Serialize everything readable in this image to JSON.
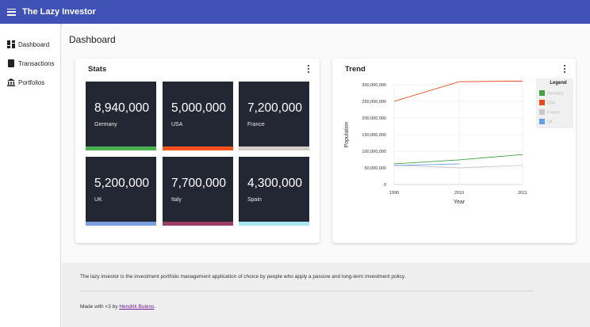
{
  "app": {
    "title": "The Lazy Investor"
  },
  "sidebar": {
    "items": [
      {
        "label": "Dashboard",
        "icon": "dashboard-icon"
      },
      {
        "label": "Transactions",
        "icon": "book-icon"
      },
      {
        "label": "Portfolios",
        "icon": "bank-icon"
      }
    ]
  },
  "page": {
    "title": "Dashboard"
  },
  "stats_card": {
    "title": "Stats",
    "items": [
      {
        "value": "8,940,000",
        "label": "Germany",
        "color": "#4caf50"
      },
      {
        "value": "5,000,000",
        "label": "USA",
        "color": "#f4511e"
      },
      {
        "value": "7,200,000",
        "label": "France",
        "color": "#d7ccc8"
      },
      {
        "value": "5,200,000",
        "label": "UK",
        "color": "#7b9fe0"
      },
      {
        "value": "7,700,000",
        "label": "Italy",
        "color": "#9c3d63"
      },
      {
        "value": "4,300,000",
        "label": "Spain",
        "color": "#a9e5f2"
      }
    ]
  },
  "trend_card": {
    "title": "Trend"
  },
  "chart_data": {
    "type": "line",
    "title": "",
    "xlabel": "Year",
    "ylabel": "Population",
    "x": [
      "1990",
      "2010",
      "2011"
    ],
    "ylim": [
      0,
      300000000
    ],
    "yticks": [
      "0",
      "50,000,000",
      "100,000,000",
      "150,000,000",
      "200,000,000",
      "250,000,000",
      "300,000,000"
    ],
    "legend_title": "Legend",
    "legend_position": "right",
    "grid": true,
    "series": [
      {
        "name": "Germany",
        "color": "#43a047",
        "values": [
          62000000,
          74000000,
          90000000
        ]
      },
      {
        "name": "USA",
        "color": "#e64a19",
        "values": [
          250000000,
          309000000,
          311000000
        ]
      },
      {
        "name": "France",
        "color": "#c8c8c8",
        "values": [
          58000000,
          50000000,
          58000000
        ]
      },
      {
        "name": "UK",
        "color": "#64a0e8",
        "values": [
          57000000,
          62000000,
          null
        ]
      }
    ]
  },
  "footer": {
    "text": "The lazy investor is the investment portfolio management application of choice by people who apply a passive and long-term investment policy.",
    "made_prefix": "Made with <3 by ",
    "author": "Hendrik Bulens",
    "made_suffix": "."
  }
}
